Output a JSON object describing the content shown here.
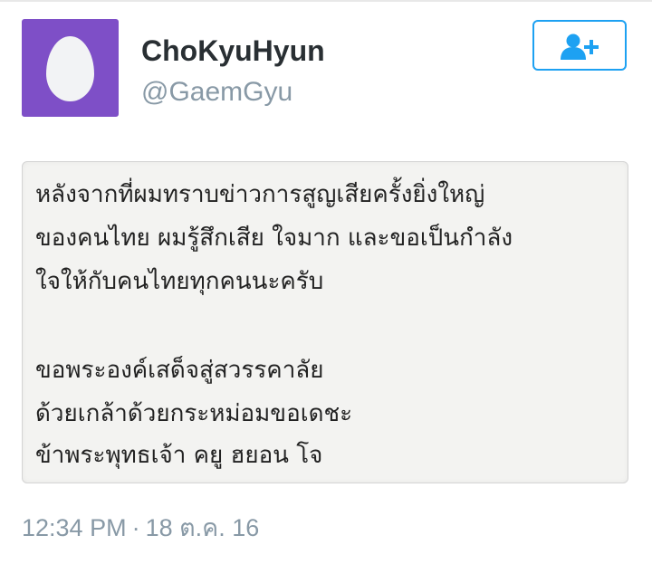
{
  "profile": {
    "display_name": "ChoKyuHyun",
    "handle": "@GaemGyu",
    "avatar_icon": "default-egg-avatar",
    "avatar_color": "#7e4fc7"
  },
  "follow_button": {
    "icon": "add-user-icon",
    "accent_color": "#1da1f2"
  },
  "tweet": {
    "lines": [
      "หลังจากที่ผมทราบข่าวการสูญเสียครั้งยิ่งใหญ่",
      "ของคนไทย ผมรู้สึกเสีย ใจมาก และขอเป็นกำลัง",
      "ใจให้กับคนไทยทุกคนนะครับ",
      "ขอพระองค์เสด็จสู่สวรรคาลัย",
      "ด้วยเกล้าด้วยกระหม่อมขอเดชะ",
      "ข้าพระพุทธเจ้า คยู ฮยอน โจ"
    ]
  },
  "meta": {
    "time": "12:34 PM",
    "separator": "·",
    "date": "18 ต.ค. 16"
  }
}
